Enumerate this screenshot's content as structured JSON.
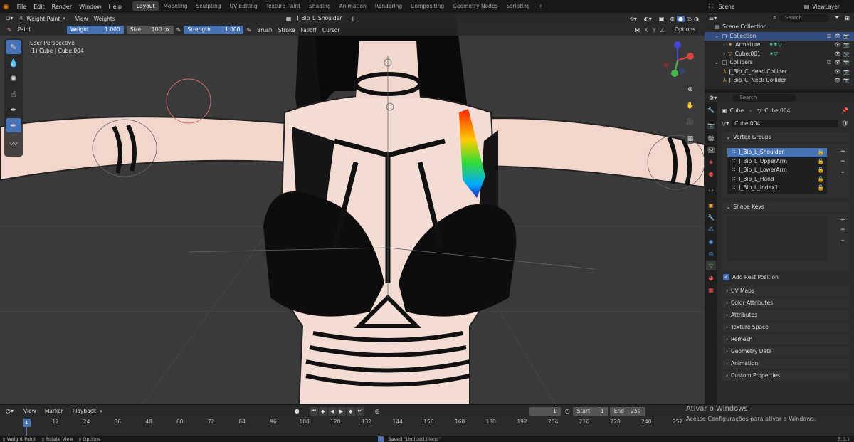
{
  "menubar": {
    "menus": [
      "File",
      "Edit",
      "Render",
      "Window",
      "Help"
    ],
    "workspace_tabs": [
      "Layout",
      "Modeling",
      "Sculpting",
      "UV Editing",
      "Texture Paint",
      "Shading",
      "Animation",
      "Rendering",
      "Compositing",
      "Geometry Nodes",
      "Scripting"
    ],
    "active_tab": "Layout",
    "add_tab": "+",
    "scene_label": "Scene",
    "view_layer_label": "ViewLayer"
  },
  "viewport_header": {
    "mode": "Weight Paint",
    "menus": [
      "View",
      "Weights"
    ],
    "active_group": "J_Bip_L_Shoulder"
  },
  "tool_header": {
    "brush_name": "Paint",
    "weight_label": "Weight",
    "weight_value": "1.000",
    "size_label": "Size",
    "size_value": "100 px",
    "strength_label": "Strength",
    "strength_value": "1.000",
    "dropdowns": [
      "Brush",
      "Stroke",
      "Falloff",
      "Cursor"
    ],
    "axes": [
      "X",
      "Y",
      "Z"
    ],
    "options": "Options"
  },
  "viewport": {
    "perspective": "User Perspective",
    "object_info": "(1) Cube | Cube.004"
  },
  "outliner": {
    "search_placeholder": "Search",
    "items": [
      {
        "label": "Scene Collection",
        "indent": 0
      },
      {
        "label": "Collection",
        "indent": 1
      },
      {
        "label": "Armature",
        "indent": 2
      },
      {
        "label": "Cube.001",
        "indent": 2
      },
      {
        "label": "Colliders",
        "indent": 1
      },
      {
        "label": "J_Bip_C_Head Collider",
        "indent": 2
      },
      {
        "label": "J_Bip_C_Neck Collider",
        "indent": 2
      }
    ]
  },
  "properties": {
    "search_placeholder": "Search",
    "breadcrumb_object": "Cube",
    "breadcrumb_mesh": "Cube.004",
    "mesh_name": "Cube.004",
    "vertex_groups_title": "Vertex Groups",
    "vertex_groups": [
      "J_Bip_L_Shoulder",
      "J_Bip_L_UpperArm",
      "J_Bip_L_LowerArm",
      "J_Bip_L_Hand",
      "J_Bip_L_Index1"
    ],
    "shape_keys_title": "Shape Keys",
    "add_rest_position": "Add Rest Position",
    "collapsed_panels": [
      "UV Maps",
      "Color Attributes",
      "Attributes",
      "Texture Space",
      "Remesh",
      "Geometry Data",
      "Animation",
      "Custom Properties"
    ]
  },
  "timeline": {
    "menus": [
      "View",
      "Marker"
    ],
    "playback": "Playback",
    "current_frame": "1",
    "start_label": "Start",
    "start_value": "1",
    "end_label": "End",
    "end_value": "250",
    "ruler": [
      "12",
      "24",
      "36",
      "48",
      "60",
      "72",
      "84",
      "96",
      "108",
      "120",
      "132",
      "144",
      "156",
      "168",
      "180",
      "192",
      "204",
      "216",
      "228",
      "240",
      "252"
    ],
    "current_marker": "1"
  },
  "statusbar": {
    "left_items": [
      "Weight Paint",
      "Rotate View",
      "Options"
    ],
    "message": "Saved \"Untitled.blend\"",
    "version": "5.0.1"
  },
  "watermark": {
    "title": "Ativar o Windows",
    "subtitle": "Acesse Configurações para ativar o Windows."
  },
  "colors": {
    "accent": "#4772b3",
    "selection": "#334d80",
    "viewport_bg": "#3a3a3a"
  }
}
